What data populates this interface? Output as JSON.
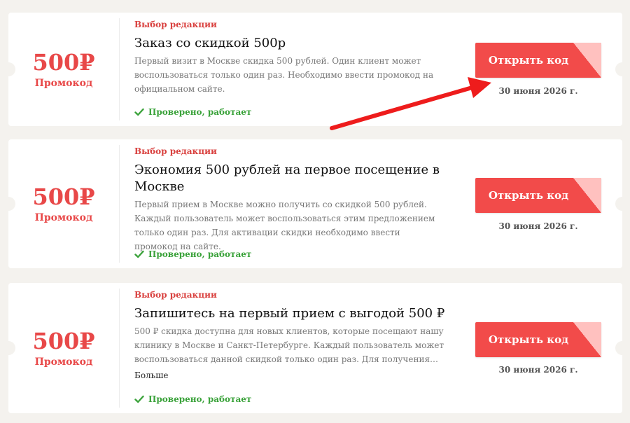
{
  "colors": {
    "accent": "#f24b4a",
    "promo": "#e84848",
    "verified": "#3aa23a",
    "arrow": "#ee1c1c"
  },
  "offers": [
    {
      "amount": "500₽",
      "kind": "Промокод",
      "tag": "Выбор редакции",
      "title": "Заказ со скидкой 500р",
      "description": "Первый визит в Москве скидка 500 рублей. Один клиент может воспользоваться только один раз. Необходимо ввести промокод на официальном сайте.",
      "verified": "Проверено, работает",
      "button_label": "Открыть код",
      "expires": "30 июня 2026 г.",
      "more": ""
    },
    {
      "amount": "500₽",
      "kind": "Промокод",
      "tag": "Выбор редакции",
      "title": "Экономия 500 рублей на первое посещение в Москве",
      "description": "Первый прием в Москве можно получить со скидкой 500 рублей. Каждый пользователь может воспользоваться этим предложением только один раз. Для активации скидки необходимо ввести промокод на сайте.",
      "verified": "Проверено, работает",
      "button_label": "Открыть код",
      "expires": "30 июня 2026 г.",
      "more": ""
    },
    {
      "amount": "500₽",
      "kind": "Промокод",
      "tag": "Выбор редакции",
      "title": "Запишитесь на первый прием с выгодой 500 ₽",
      "description": "500 ₽ скидка доступна для новых клиентов, которые посещают нашу клинику в Москве и Санкт-Петербурге. Каждый пользователь может воспользоваться данной скидкой только один раз. Для получения скидки необходимо ввести промокод на сайте.",
      "verified": "Проверено, работает",
      "button_label": "Открыть код",
      "expires": "30 июня 2026 г.",
      "more": "Больше"
    }
  ]
}
